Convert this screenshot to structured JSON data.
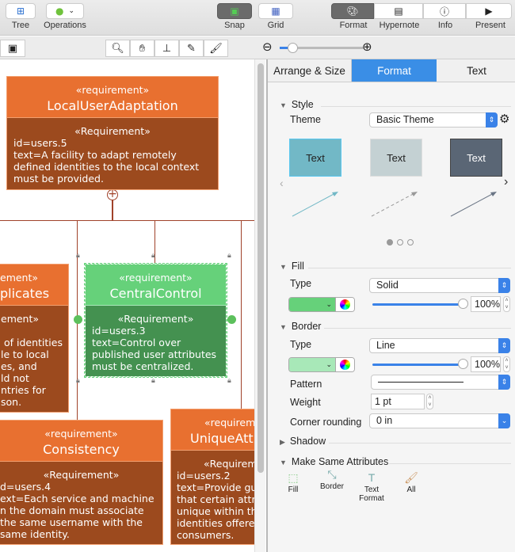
{
  "toolbar": {
    "tree": "Tree",
    "operations": "Operations",
    "snap": "Snap",
    "grid": "Grid",
    "format": "Format",
    "hypernote": "Hypernote",
    "info": "Info",
    "present": "Present"
  },
  "canvas": {
    "blocks": [
      {
        "stereotype": "«requirement»",
        "name": "LocalUserAdaptation",
        "body_stereotype": "«Requirement»",
        "lines": [
          "id=users.5",
          "text=A facility to adapt remotely",
          "defined identities to the local context",
          "must be provided."
        ]
      },
      {
        "stereotype": "ement»",
        "name": "plicates",
        "body_stereotype": "ement»",
        "lines": [
          "",
          " of identities",
          "le to local",
          "es, and",
          "ld not",
          "ntries for",
          "son."
        ]
      },
      {
        "stereotype": "«requirement»",
        "name": "CentralControl",
        "body_stereotype": "«Requirement»",
        "lines": [
          "id=users.3",
          "text=Control over",
          "published user attributes",
          "must be centralized."
        ]
      },
      {
        "stereotype": "«requirement»",
        "name": "Consistency",
        "body_stereotype": "«Requirement»",
        "lines": [
          "d=users.4",
          "ext=Each service and machine",
          "n the domain must associate",
          "the same username with the",
          "same identity."
        ]
      },
      {
        "stereotype": "«requirem",
        "name": "UniqueAttr",
        "body_stereotype": "«Requirem",
        "lines": [
          "id=users.2",
          "text=Provide gu",
          "that certain attr",
          "unique within th",
          "identities offere",
          "consumers."
        ]
      }
    ],
    "colors": {
      "orange": "#e87030",
      "brown": "#9c4a1e",
      "green": "#66d17a",
      "dark_green": "#449150"
    }
  },
  "zoom": {
    "level": 0.15
  },
  "panel": {
    "tabs": [
      "Arrange & Size",
      "Format",
      "Text"
    ],
    "active_tab": "Format",
    "style": {
      "title": "Style",
      "theme_label": "Theme",
      "theme_value": "Basic Theme",
      "swatch_text": "Text",
      "page": 1,
      "pages": 3
    },
    "fill": {
      "title": "Fill",
      "type_label": "Type",
      "type_value": "Solid",
      "color": "#66d17a",
      "opacity": "100%"
    },
    "border": {
      "title": "Border",
      "type_label": "Type",
      "type_value": "Line",
      "color": "#a8e8b8",
      "opacity": "100%",
      "pattern_label": "Pattern",
      "weight_label": "Weight",
      "weight_value": "1 pt",
      "corner_label": "Corner rounding",
      "corner_value": "0 in"
    },
    "shadow": {
      "title": "Shadow"
    },
    "make_same": {
      "title": "Make Same Attributes",
      "items": [
        "Fill",
        "Border",
        "Text\nFormat",
        "All"
      ]
    }
  }
}
